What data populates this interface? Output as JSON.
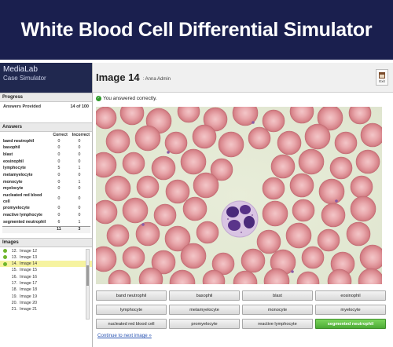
{
  "banner": {
    "title": "White Blood Cell Differential Simulator"
  },
  "brand": {
    "name": "MediaLab",
    "subtitle": "Case Simulator"
  },
  "progress": {
    "section_label": "Progress",
    "answers_label": "Answers Provided",
    "answers_value": "14 of 100"
  },
  "answers": {
    "section_label": "Answers",
    "col_correct": "Correct",
    "col_incorrect": "Incorrect",
    "rows": [
      {
        "label": "band neutrophil",
        "correct": "0",
        "incorrect": "0"
      },
      {
        "label": "basophil",
        "correct": "0",
        "incorrect": "0"
      },
      {
        "label": "blast",
        "correct": "0",
        "incorrect": "0"
      },
      {
        "label": "eosinophil",
        "correct": "0",
        "incorrect": "0"
      },
      {
        "label": "lymphocyte",
        "correct": "5",
        "incorrect": "1"
      },
      {
        "label": "metamyelocyte",
        "correct": "0",
        "incorrect": "0"
      },
      {
        "label": "monocyte",
        "correct": "0",
        "incorrect": "1"
      },
      {
        "label": "myelocyte",
        "correct": "0",
        "incorrect": "0"
      },
      {
        "label": "nucleated red blood cell",
        "correct": "0",
        "incorrect": "0"
      },
      {
        "label": "promyelocyte",
        "correct": "0",
        "incorrect": "0"
      },
      {
        "label": "reactive lymphocyte",
        "correct": "0",
        "incorrect": "0"
      },
      {
        "label": "segmented neutrophil",
        "correct": "6",
        "incorrect": "1"
      }
    ],
    "total_correct": "11",
    "total_incorrect": "3"
  },
  "images": {
    "section_label": "Images",
    "items": [
      {
        "num": "12.",
        "label": "Image 12",
        "done": true,
        "current": false
      },
      {
        "num": "13.",
        "label": "Image 13",
        "done": true,
        "current": false
      },
      {
        "num": "14.",
        "label": "Image 14",
        "done": true,
        "current": true
      },
      {
        "num": "15.",
        "label": "Image 15",
        "done": false,
        "current": false
      },
      {
        "num": "16.",
        "label": "Image 16",
        "done": false,
        "current": false
      },
      {
        "num": "17.",
        "label": "Image 17",
        "done": false,
        "current": false
      },
      {
        "num": "18.",
        "label": "Image 18",
        "done": false,
        "current": false
      },
      {
        "num": "19.",
        "label": "Image 19",
        "done": false,
        "current": false
      },
      {
        "num": "20.",
        "label": "Image 20",
        "done": false,
        "current": false
      },
      {
        "num": "21.",
        "label": "Image 21",
        "done": false,
        "current": false
      }
    ]
  },
  "header": {
    "title": "Image 14",
    "user": ": Anna Admin",
    "exit_label": "Exit"
  },
  "status": {
    "message": "You answered correctly.",
    "icon": "check-icon"
  },
  "options": [
    {
      "label": "band neutrophil",
      "correct": false
    },
    {
      "label": "basophil",
      "correct": false
    },
    {
      "label": "blast",
      "correct": false
    },
    {
      "label": "eosinophil",
      "correct": false
    },
    {
      "label": "lymphocyte",
      "correct": false
    },
    {
      "label": "metamyelocyte",
      "correct": false
    },
    {
      "label": "monocyte",
      "correct": false
    },
    {
      "label": "myelocyte",
      "correct": false
    },
    {
      "label": "nucleated red blood cell",
      "correct": false
    },
    {
      "label": "promyelocyte",
      "correct": false
    },
    {
      "label": "reactive lymphocyte",
      "correct": false
    },
    {
      "label": "segmented neutrophil",
      "correct": true
    }
  ],
  "next_link": "Continue to next image »",
  "colors": {
    "banner": "#1a1f4e",
    "brand": "#20284f",
    "correct_button": "#4caa35",
    "link": "#2a55b3",
    "current_row": "#f6f3a0"
  }
}
